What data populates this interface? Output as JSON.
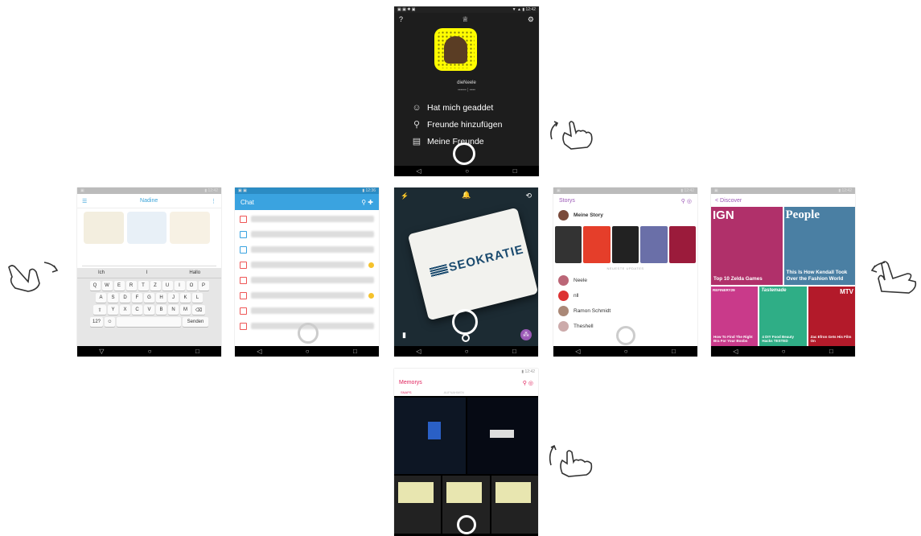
{
  "profile": {
    "username": "dieNeele",
    "menu": [
      {
        "icon": "smiley-icon",
        "label": "Hat mich geaddet"
      },
      {
        "icon": "add-friend-icon",
        "label": "Freunde hinzufügen"
      },
      {
        "icon": "book-icon",
        "label": "Meine Freunde"
      }
    ]
  },
  "chat_conversation": {
    "title": "Nadine",
    "keyboard": {
      "suggestions": [
        "Ich",
        "I",
        "Hallo"
      ],
      "row1": [
        "Q",
        "W",
        "E",
        "R",
        "T",
        "Z",
        "U",
        "I",
        "O",
        "P"
      ],
      "row2": [
        "A",
        "S",
        "D",
        "F",
        "G",
        "H",
        "J",
        "K",
        "L"
      ],
      "row3": [
        "Y",
        "X",
        "C",
        "V",
        "B",
        "N",
        "M"
      ],
      "send": "Senden"
    }
  },
  "chat_list": {
    "title": "Chat"
  },
  "camera": {
    "poster_text": "SEOKRATIE"
  },
  "stories": {
    "title": "Storys",
    "my_story": "Meine Story",
    "section_label": "NEUESTE UPDATES",
    "friends": [
      "Neele",
      "nll",
      "Ramon Schmidt",
      "Theshell"
    ]
  },
  "discover": {
    "back_label": "< Discover",
    "tiles": [
      {
        "brand": "IGN",
        "caption": "Top 10 Zelda Games",
        "color": "#b0306a"
      },
      {
        "brand": "People",
        "caption": "This Is How Kendall Took Over the Fashion World",
        "color": "#4a7fa3"
      },
      {
        "brand": "REFINERY29",
        "caption": "How To Find The Right Bra For Your Boobs",
        "color": "#c93a8a"
      },
      {
        "brand": "Tastemade",
        "caption": "4 DIY Food Beauty Hacks TESTED",
        "color": "#2fae86"
      },
      {
        "brand": "MTV",
        "caption": "Zac Efron Gets His Film On",
        "color": "#b31a2a"
      }
    ]
  },
  "memories": {
    "title": "Memorys",
    "tabs": [
      "SNAPS",
      "AUFNAHMEN"
    ]
  },
  "colors": {
    "snap_yellow": "#fffc00",
    "chat_blue": "#3aa3e0",
    "stories_purple": "#9b59b6",
    "memories_pink": "#e0245e"
  }
}
